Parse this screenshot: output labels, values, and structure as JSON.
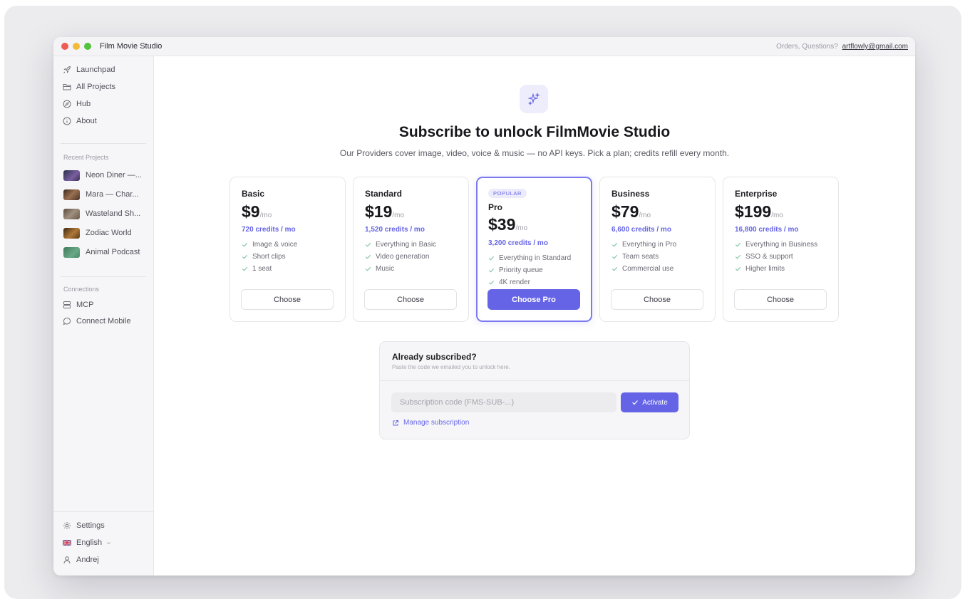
{
  "app": {
    "title": "Film Movie Studio",
    "contact_prefix": "Orders, Questions?",
    "contact_email": "artflowly@gmail.com"
  },
  "sidebar": {
    "nav": [
      {
        "label": "Launchpad",
        "icon": "rocket-icon"
      },
      {
        "label": "All Projects",
        "icon": "folder-icon"
      },
      {
        "label": "Hub",
        "icon": "compass-icon"
      },
      {
        "label": "About",
        "icon": "info-icon"
      }
    ],
    "recent_label": "Recent Projects",
    "recent": [
      {
        "label": "Neon Diner —...",
        "color": "#3a3f5c"
      },
      {
        "label": "Mara — Char...",
        "color": "#5b4636"
      },
      {
        "label": "Wasteland Sh...",
        "color": "#7a6a5a"
      },
      {
        "label": "Zodiac World",
        "color": "#6b4a2a"
      },
      {
        "label": "Animal Podcast",
        "color": "#4f8a6a"
      }
    ],
    "connections_label": "Connections",
    "connections": [
      {
        "label": "MCP",
        "icon": "server-icon"
      },
      {
        "label": "Connect Mobile",
        "icon": "chat-bubble-icon"
      }
    ],
    "footer": {
      "settings": "Settings",
      "language": "English",
      "user": "Andrej"
    }
  },
  "main": {
    "headline": "Subscribe to unlock FilmMovie Studio",
    "subline": "Our Providers cover image, video, voice & music — no API keys. Pick a plan; credits refill every month.",
    "plans": [
      {
        "name": "Basic",
        "price": "$9",
        "per": "/mo",
        "credits": "720 credits / mo",
        "features": [
          "Image & voice",
          "Short clips",
          "1 seat"
        ],
        "cta": "Choose"
      },
      {
        "name": "Standard",
        "price": "$19",
        "per": "/mo",
        "credits": "1,520 credits / mo",
        "features": [
          "Everything in Basic",
          "Video generation",
          "Music"
        ],
        "cta": "Choose"
      },
      {
        "name": "Pro",
        "price": "$39",
        "per": "/mo",
        "credits": "3,200 credits / mo",
        "badge": "POPULAR",
        "features": [
          "Everything in Standard",
          "Priority queue",
          "4K render"
        ],
        "cta": "Choose Pro"
      },
      {
        "name": "Business",
        "price": "$79",
        "per": "/mo",
        "credits": "6,600 credits / mo",
        "features": [
          "Everything in Pro",
          "Team seats",
          "Commercial use"
        ],
        "cta": "Choose"
      },
      {
        "name": "Enterprise",
        "price": "$199",
        "per": "/mo",
        "credits": "16,800 credits / mo",
        "features": [
          "Everything in Business",
          "SSO & support",
          "Higher limits"
        ],
        "cta": "Choose"
      }
    ],
    "subscribed": {
      "title": "Already subscribed?",
      "hint": "Paste the code we emailed you to unlock here.",
      "placeholder": "Subscription code (FMS-SUB-...)",
      "value": "",
      "activate": "Activate",
      "manage": "Manage subscription"
    }
  },
  "colors": {
    "accent": "#6564e6",
    "accent_soft": "#ecebfb",
    "check": "#7ac2a0"
  }
}
